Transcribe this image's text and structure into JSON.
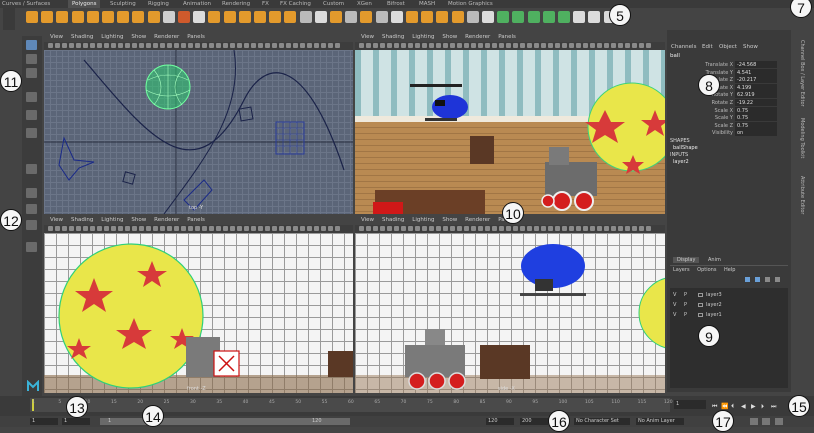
{
  "shelf": {
    "tabs": [
      "Curves / Surfaces",
      "Polygons",
      "Sculpting",
      "Rigging",
      "Animation",
      "Rendering",
      "FX",
      "FX Caching",
      "Custom",
      "XGen",
      "Bifrost",
      "MASH",
      "Motion Graphics"
    ],
    "active_tab": "Polygons"
  },
  "viewport_menu": [
    "View",
    "Shading",
    "Lighting",
    "Show",
    "Renderer",
    "Panels"
  ],
  "viewports": {
    "top": {
      "label": "top -Y"
    },
    "persp": {
      "label": ""
    },
    "front": {
      "label": "front -Z"
    },
    "side": {
      "label": "side -X"
    }
  },
  "channel_box": {
    "menu": [
      "Channels",
      "Edit",
      "Object",
      "Show"
    ],
    "object": "ball",
    "attributes": [
      {
        "name": "Translate X",
        "value": "-24.568"
      },
      {
        "name": "Translate Y",
        "value": "4.541"
      },
      {
        "name": "Translate Z",
        "value": "-20.217"
      },
      {
        "name": "Rotate X",
        "value": "4.199"
      },
      {
        "name": "Rotate Y",
        "value": "62.919"
      },
      {
        "name": "Rotate Z",
        "value": "-19.22"
      },
      {
        "name": "Scale X",
        "value": "0.75"
      },
      {
        "name": "Scale Y",
        "value": "0.75"
      },
      {
        "name": "Scale Z",
        "value": "0.75"
      },
      {
        "name": "Visibility",
        "value": "on"
      }
    ],
    "shapes_header": "SHAPES",
    "shape": "ballShape",
    "inputs_header": "INPUTS",
    "input": "layer2"
  },
  "side_tabs": [
    "Channel Box / Layer Editor",
    "Modeling Toolkit",
    "Attribute Editor"
  ],
  "layer_editor": {
    "tabs": [
      "Display",
      "Anim"
    ],
    "menu": [
      "Layers",
      "Options",
      "Help"
    ],
    "layers": [
      {
        "v": "V",
        "p": "P",
        "name": "layer3"
      },
      {
        "v": "V",
        "p": "P",
        "name": "layer2"
      },
      {
        "v": "V",
        "p": "P",
        "name": "layer1"
      }
    ]
  },
  "timeline": {
    "ticks": [
      "1",
      "5",
      "10",
      "15",
      "20",
      "25",
      "30",
      "35",
      "40",
      "45",
      "50",
      "55",
      "60",
      "65",
      "70",
      "75",
      "80",
      "85",
      "90",
      "95",
      "100",
      "105",
      "110",
      "115",
      "120"
    ],
    "current_frame": "1"
  },
  "range": {
    "start": "1",
    "inner_start": "1",
    "inner_end": "120",
    "end": "120",
    "anim_end": "200",
    "character_set": "No Character Set",
    "anim_layer": "No Anim Layer"
  },
  "callouts": [
    "5",
    "7",
    "8",
    "9",
    "10",
    "11",
    "12",
    "13",
    "14",
    "15",
    "16",
    "17"
  ],
  "colors": {
    "accent": "#5fa0d8",
    "ball_yellow": "#e9e64a",
    "star_red": "#d73a3a",
    "heli_blue": "#1f3fe0"
  }
}
